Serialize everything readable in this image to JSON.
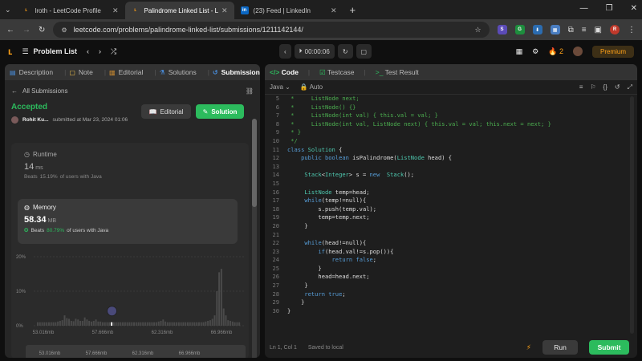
{
  "browser": {
    "tabs": [
      {
        "label": "lroth - LeetCode Profile",
        "icon": "leetcode-favicon"
      },
      {
        "label": "Palindrome Linked List - LeetCo",
        "icon": "leetcode-favicon"
      },
      {
        "label": "(23) Feed | LinkedIn",
        "icon": "linkedin-favicon"
      }
    ],
    "url": "leetcode.com/problems/palindrome-linked-list/submissions/1211142144/"
  },
  "topbar": {
    "problem_list": "Problem List",
    "timer": "00:00:06",
    "streak": "2",
    "premium": "Premium"
  },
  "left_tabs": [
    {
      "label": "Description"
    },
    {
      "label": "Note"
    },
    {
      "label": "Editorial"
    },
    {
      "label": "Solutions"
    },
    {
      "label": "Submissions"
    }
  ],
  "submission": {
    "back": "All Submissions",
    "status": "Accepted",
    "user": "Rohit Ku...",
    "submitted": "submitted at Mar 23, 2024 01:06",
    "editorial_btn": "Editorial",
    "solution_btn": "Solution",
    "runtime_title": "Runtime",
    "runtime_value": "14",
    "runtime_unit": "ms",
    "runtime_beats_prefix": "Beats",
    "runtime_beats_pct": "15.19%",
    "runtime_beats_suffix": "of users with Java",
    "memory_title": "Memory",
    "memory_value": "58.34",
    "memory_unit": "MB",
    "memory_beats_prefix": "Beats",
    "memory_beats_pct": "80.79%",
    "memory_beats_suffix": "of users with Java"
  },
  "chart_data": {
    "type": "bar",
    "yticks": [
      "20%",
      "10%",
      "0%"
    ],
    "ylim": [
      0,
      20
    ],
    "xticks": [
      "53.016mb",
      "57.666mb",
      "62.316mb",
      "66.966mb"
    ],
    "mini_xticks": [
      "53.016mb",
      "57.666mb",
      "62.316mb",
      "66.966mb"
    ],
    "values": [
      1,
      1,
      1,
      1,
      1,
      1,
      1,
      1,
      1,
      1.2,
      1.4,
      1.6,
      3,
      2.2,
      2,
      1.4,
      1.3,
      2,
      1.8,
      1.4,
      1.4,
      2.4,
      1.8,
      1.4,
      1.2,
      1.4,
      1.8,
      1.2,
      1.2,
      1,
      1,
      1,
      1,
      1,
      1,
      1,
      1,
      1,
      1,
      1,
      1,
      1,
      1,
      1,
      1,
      1,
      1,
      1,
      1,
      1,
      1,
      1,
      1,
      1,
      1.2,
      1.4,
      1.8,
      1.2,
      1,
      1,
      1,
      1,
      1,
      1,
      1,
      1,
      1,
      1,
      1,
      1,
      1,
      1,
      1,
      1,
      1,
      1.2,
      1.4,
      1.6,
      2,
      3,
      4,
      6,
      7,
      5,
      3,
      1.6,
      1.4,
      1.2,
      1,
      1,
      1
    ],
    "highlight_index": 33,
    "big_bars": [
      {
        "index": 81,
        "value": 15.5
      },
      {
        "index": 82,
        "value": 16.5
      },
      {
        "index": 80,
        "value": 10
      }
    ]
  },
  "editor": {
    "tabs": [
      {
        "label": "Code"
      },
      {
        "label": "Testcase"
      },
      {
        "label": "Test Result"
      }
    ],
    "language": "Java",
    "mode": "Auto",
    "lines": [
      {
        "n": "5",
        "text": " *     ListNode next;"
      },
      {
        "n": "6",
        "text": " *     ListNode() {}"
      },
      {
        "n": "7",
        "text": " *     ListNode(int val) { this.val = val; }"
      },
      {
        "n": "8",
        "text": " *     ListNode(int val, ListNode next) { this.val = val; this.next = next; }"
      },
      {
        "n": "9",
        "text": " * }"
      },
      {
        "n": "10",
        "text": " */"
      },
      {
        "n": "11",
        "text": "class Solution {"
      },
      {
        "n": "12",
        "text": "    public boolean isPalindrome(ListNode head) {"
      },
      {
        "n": "13",
        "text": ""
      },
      {
        "n": "14",
        "text": "     Stack<Integer> s = new  Stack();"
      },
      {
        "n": "15",
        "text": ""
      },
      {
        "n": "16",
        "text": "     ListNode temp=head;"
      },
      {
        "n": "17",
        "text": "     while(temp!=null){"
      },
      {
        "n": "18",
        "text": "         s.push(temp.val);"
      },
      {
        "n": "19",
        "text": "         temp=temp.next;"
      },
      {
        "n": "20",
        "text": "     }"
      },
      {
        "n": "21",
        "text": ""
      },
      {
        "n": "22",
        "text": "     while(head!=null){"
      },
      {
        "n": "23",
        "text": "         if(head.val!=s.pop()){"
      },
      {
        "n": "24",
        "text": "             return false;"
      },
      {
        "n": "25",
        "text": "         }"
      },
      {
        "n": "26",
        "text": "         head=head.next;"
      },
      {
        "n": "27",
        "text": "     }"
      },
      {
        "n": "28",
        "text": "     return true;"
      },
      {
        "n": "29",
        "text": "    }"
      },
      {
        "n": "30",
        "text": "}"
      }
    ],
    "status": "Ln 1, Col 1",
    "saved": "Saved to local",
    "run": "Run",
    "submit": "Submit"
  },
  "colors": {
    "accent": "#2cbb5d",
    "brand": "#ffa116",
    "comment": "#4caf50",
    "keyword": "#569cd6",
    "type": "#4ec9b0"
  }
}
